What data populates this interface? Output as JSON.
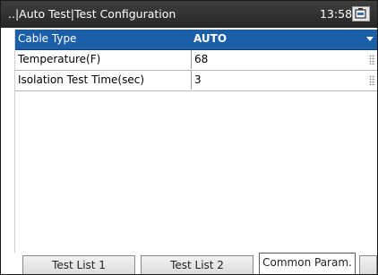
{
  "titlebar": {
    "title": "..|Auto Test|Test Configuration",
    "time": "13:58",
    "status_icon": "battery-icon"
  },
  "params": [
    {
      "label": "Cable Type",
      "value": "AUTO",
      "control": "dropdown"
    },
    {
      "label": "Temperature(F)",
      "value": "68",
      "control": "edit"
    },
    {
      "label": "Isolation Test Time(sec)",
      "value": "3",
      "control": "edit"
    }
  ],
  "tabs": [
    {
      "label": "Test List 1"
    },
    {
      "label": "Test List 2"
    },
    {
      "label": "Common Param."
    }
  ],
  "colors": {
    "selection": "#1b5fa8",
    "titlebar": "#2f2f2f"
  }
}
